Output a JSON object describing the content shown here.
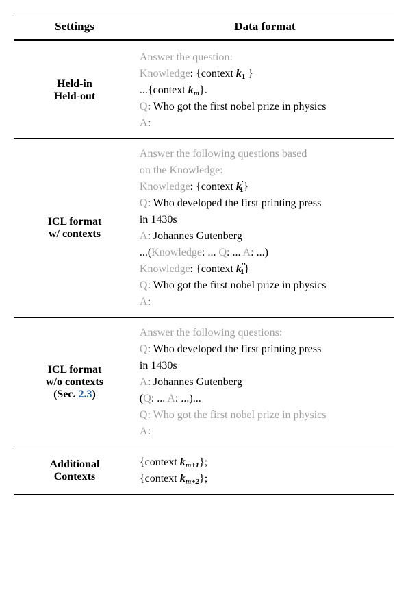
{
  "headers": {
    "col1": "Settings",
    "col2": "Data format"
  },
  "rows": [
    {
      "setting": "Held-in\nHeld-out",
      "lines": [
        {
          "pre": "Answer the question",
          "colon_gray": true,
          "text": "",
          "black_text": ""
        },
        {
          "pre": "Knowledge",
          "colon_gray": false,
          "text": ": {context ",
          "var": "k",
          "sub": "1",
          "tail": " }"
        },
        {
          "black_line": "...{context ",
          "var": "k",
          "sub": "m",
          "black_tail": "}."
        },
        {
          "q_line": true,
          "q_text": ": Who got the first nobel prize in physics"
        },
        {
          "a_line": true,
          "a_text": ":"
        }
      ]
    },
    {
      "setting": "ICL format\nw/ contexts",
      "lines": [
        {
          "pre": "Answer the following questions based",
          "colon_gray": true
        },
        {
          "pre": "on the Knowledge",
          "colon_gray": true,
          "has_colon": true
        },
        {
          "pre": "Knowledge",
          "text": ": {context ",
          "var": "k",
          "sub": "1",
          "sup": "′",
          "tail": "}"
        },
        {
          "q_line": true,
          "q_text": ": Who developed the first printing press"
        },
        {
          "black_plain": "in 1430s"
        },
        {
          "a_line": true,
          "a_text": ": Johannes Gutenberg"
        },
        {
          "gray_kqa": "...(",
          "kqa_k": "Knowledge",
          "kqa_mid1": ": ... ",
          "kqa_q": "Q",
          "kqa_mid2": ": ... ",
          "kqa_a": "A",
          "kqa_end": ": ...)"
        },
        {
          "pre": "Knowledge",
          "text": ": {context ",
          "var": "k",
          "sub": "1",
          "sup": "′′",
          "tail": "}"
        },
        {
          "q_line": true,
          "q_text": ": Who got the first nobel prize in physics"
        },
        {
          "a_line": true,
          "a_text": ":"
        }
      ]
    },
    {
      "setting": "ICL format\nw/o contexts\n(Sec. ",
      "link_text": "2.3",
      "setting_tail": ")",
      "lines": [
        {
          "pre": "Answer the following questions",
          "colon_gray": true,
          "has_colon": true
        },
        {
          "q_line": true,
          "q_text": ": Who developed the first printing press"
        },
        {
          "black_plain": "in 1430s"
        },
        {
          "a_line": true,
          "a_text": ": Johannes Gutenberg"
        },
        {
          "gray_qa": "(",
          "qa_q": "Q",
          "qa_mid": ": ... ",
          "qa_a": "A",
          "qa_end": ": ...)..."
        },
        {
          "q_gray_full": true,
          "q_text": ": Who got the first nobel prize in physics"
        },
        {
          "a_line": true,
          "a_text": ":"
        }
      ]
    },
    {
      "setting": "Additional\nContexts",
      "lines": [
        {
          "black_line": "{context ",
          "var": "k",
          "sub": "m+1",
          "black_tail": "};"
        },
        {
          "black_line": "{context ",
          "var": "k",
          "sub": "m+2",
          "black_tail": "};"
        }
      ]
    }
  ]
}
